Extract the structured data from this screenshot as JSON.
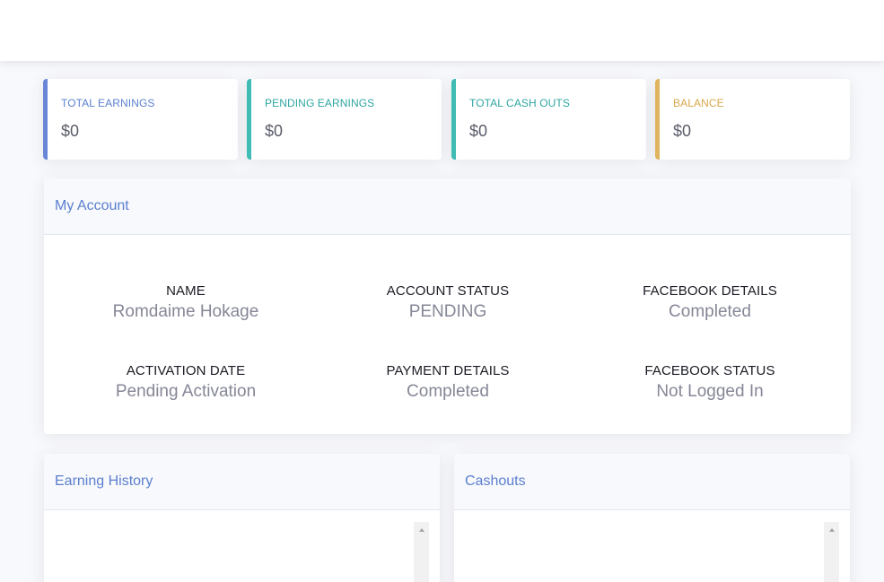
{
  "colors": {
    "primary": "#5b7fcf",
    "info": "#36b9cc",
    "success": "#1cc88a",
    "warning": "#e0b45f",
    "text_muted": "#858796"
  },
  "stats": [
    {
      "label": "TOTAL EARNINGS",
      "value": "$0",
      "color": "#6a86d6"
    },
    {
      "label": "PENDING EARNINGS",
      "value": "$0",
      "color": "#3fbcb3"
    },
    {
      "label": "TOTAL CASH OUTS",
      "value": "$0",
      "color": "#3fbcb3"
    },
    {
      "label": "BALANCE",
      "value": "$0",
      "color": "#e0b45f"
    }
  ],
  "account": {
    "title": "My Account",
    "items": [
      {
        "key": "NAME",
        "value": "Romdaime Hokage"
      },
      {
        "key": "ACCOUNT STATUS",
        "value": "PENDING"
      },
      {
        "key": "FACEBOOK DETAILS",
        "value": "Completed"
      },
      {
        "key": "ACTIVATION DATE",
        "value": "Pending Activation"
      },
      {
        "key": "PAYMENT DETAILS",
        "value": "Completed"
      },
      {
        "key": "FACEBOOK STATUS",
        "value": "Not Logged In"
      }
    ]
  },
  "earning_history": {
    "title": "Earning History"
  },
  "cashouts": {
    "title": "Cashouts"
  }
}
